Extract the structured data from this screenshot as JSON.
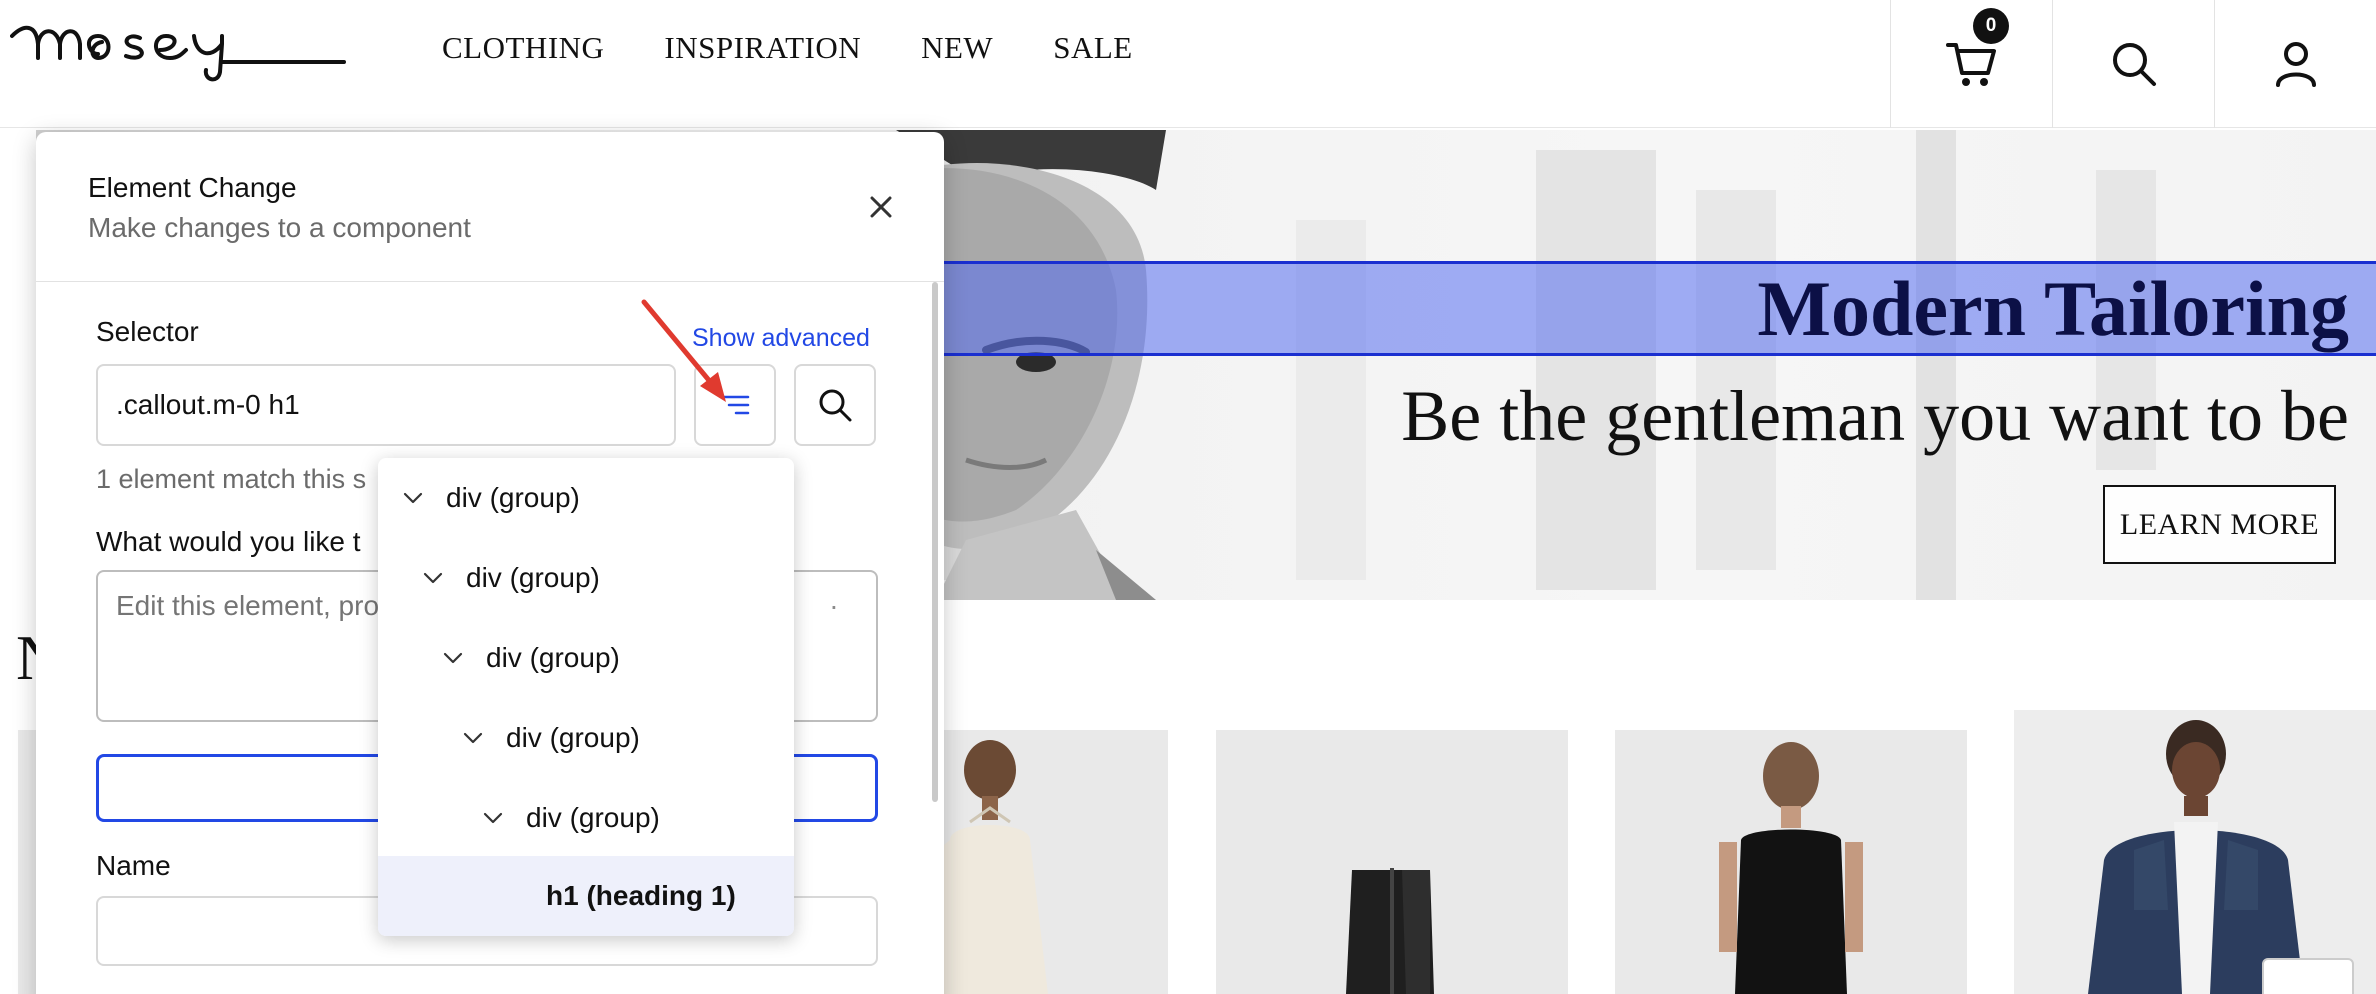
{
  "header": {
    "logo_text": "mosey",
    "nav": [
      "CLOTHING",
      "INSPIRATION",
      "NEW",
      "SALE"
    ],
    "cart_count": "0",
    "icons": [
      "cart-icon",
      "search-icon",
      "user-icon"
    ]
  },
  "hero": {
    "title": "Modern Tailoring",
    "subtitle": "Be the gentleman you want to be",
    "cta": "LEARN MORE"
  },
  "products": {
    "heading_peek": "N"
  },
  "panel": {
    "title": "Element Change",
    "subtitle": "Make changes to a component",
    "selector_label": "Selector",
    "show_advanced": "Show advanced",
    "selector_value": ".callout.m-0 h1",
    "match_text": "1 element match this s",
    "what_label": "What would you like t",
    "edit_placeholder": "Edit this element, pro",
    "edit_placeholder_tail": ".",
    "name_label": "Name"
  },
  "tree": {
    "items": [
      {
        "label": "div (group)"
      },
      {
        "label": "div (group)"
      },
      {
        "label": "div (group)"
      },
      {
        "label": "div (group)"
      },
      {
        "label": "div (group)"
      },
      {
        "label": "h1 (heading 1)"
      }
    ],
    "selected_index": 5
  },
  "colors": {
    "accent": "#2248e5",
    "highlight": "#556ef0",
    "annotation": "#e03a2f"
  }
}
